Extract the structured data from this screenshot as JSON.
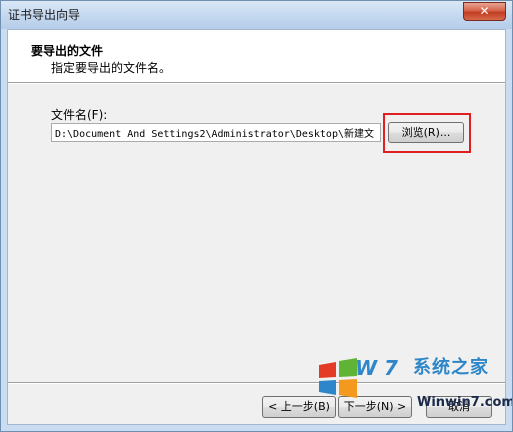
{
  "window": {
    "title": "证书导出向导",
    "close_label": "✕"
  },
  "header": {
    "title": "要导出的文件",
    "subtitle": "指定要导出的文件名。"
  },
  "form": {
    "file_label": "文件名(F):",
    "file_value": "D:\\Document And Settings2\\Administrator\\Desktop\\新建文",
    "browse_label": "浏览(R)..."
  },
  "footer": {
    "back_label": "< 上一步(B)",
    "next_label": "下一步(N) >",
    "cancel_label": "取消"
  },
  "watermark": {
    "brand_big": "W  7",
    "brand_cn": "系统之家",
    "url": "Winwin7.com",
    "colors": {
      "blue": "#2d86c9",
      "orange": "#f39a1e",
      "green": "#5fb436",
      "red": "#e43b26"
    }
  },
  "annotation": {
    "highlight_color": "#e02020"
  }
}
